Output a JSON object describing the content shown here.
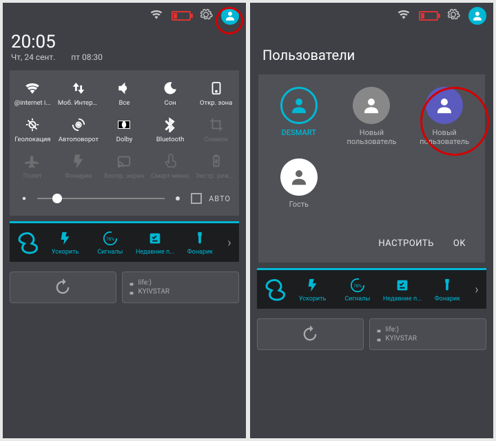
{
  "left": {
    "clock": "20:05",
    "date": "Чт, 24 сент.",
    "alarm": "пт 08:30",
    "tiles": [
      {
        "id": "wifi",
        "label": "@internet i...",
        "dim": false
      },
      {
        "id": "mobdata",
        "label": "Моб. Интернет",
        "dim": false
      },
      {
        "id": "sound",
        "label": "Все",
        "dim": false
      },
      {
        "id": "sleep",
        "label": "Сон",
        "dim": false
      },
      {
        "id": "hotspot",
        "label": "Откр. зона",
        "dim": false
      },
      {
        "id": "location",
        "label": "Геолокация",
        "dim": false
      },
      {
        "id": "rotate",
        "label": "Автоповорот",
        "dim": false
      },
      {
        "id": "dolby",
        "label": "Dolby",
        "dim": false
      },
      {
        "id": "bluetooth",
        "label": "Bluetooth",
        "dim": false
      },
      {
        "id": "screenshot",
        "label": "Снимок",
        "dim": true
      },
      {
        "id": "airplane",
        "label": "Полет",
        "dim": true
      },
      {
        "id": "flashlight",
        "label": "Фонарик",
        "dim": true
      },
      {
        "id": "cast",
        "label": "Беспр. экран",
        "dim": true
      },
      {
        "id": "smartmenu",
        "label": "Смарт-меню",
        "dim": true
      },
      {
        "id": "powersave",
        "label": "Экстр. режим",
        "dim": true
      }
    ],
    "brightness_auto": "АВТО",
    "appbar": [
      {
        "id": "boost",
        "label": "Ускорить"
      },
      {
        "id": "signals",
        "label": "Сигналы",
        "badge": "78%"
      },
      {
        "id": "recent",
        "label": "Недавние п..."
      },
      {
        "id": "flash",
        "label": "Фонарик"
      }
    ],
    "sim1": "life:)",
    "sim2": "KYIVSTAR"
  },
  "right": {
    "title": "Пользователи",
    "users": [
      {
        "id": "desmart",
        "label": "DESMART",
        "style": "ring",
        "active": true
      },
      {
        "id": "new1",
        "label": "Новый\nпользователь",
        "style": "gray"
      },
      {
        "id": "new2",
        "label": "Новый\nпользователь",
        "style": "blue"
      },
      {
        "id": "guest",
        "label": "Гость",
        "style": "white"
      }
    ],
    "btn_configure": "НАСТРОИТЬ",
    "btn_ok": "OK",
    "appbar": [
      {
        "id": "boost",
        "label": "Ускорить"
      },
      {
        "id": "signals",
        "label": "Сигналы",
        "badge": "78%"
      },
      {
        "id": "recent",
        "label": "Недавние п..."
      },
      {
        "id": "flash",
        "label": "Фонарик"
      }
    ],
    "sim1": "life:)",
    "sim2": "KYIVSTAR"
  }
}
